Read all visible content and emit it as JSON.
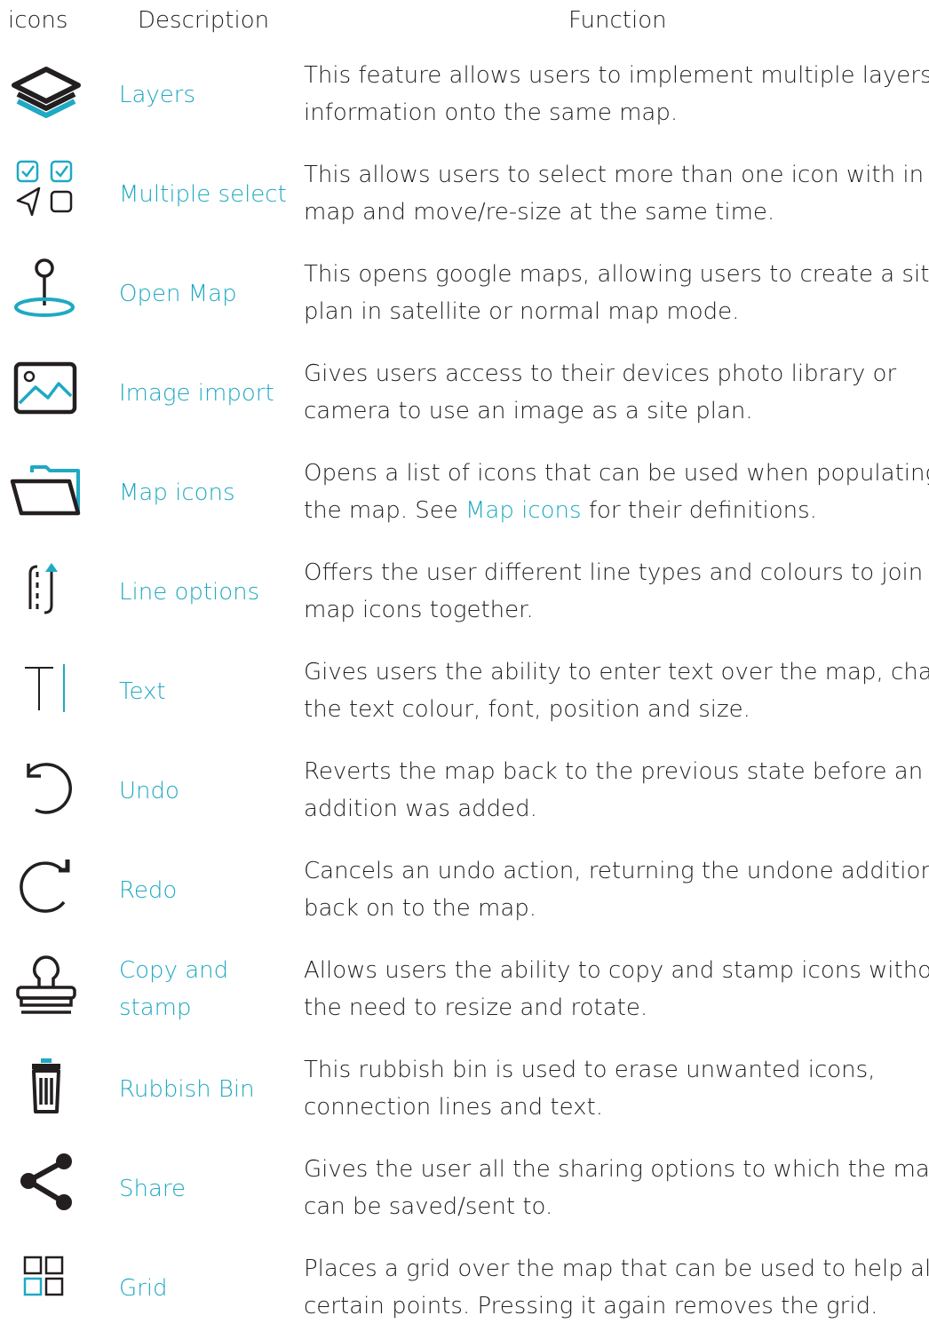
{
  "header": {
    "icons": "icons",
    "description": "Description",
    "function": "Function"
  },
  "colors": {
    "accent": "#1fa9c3",
    "text": "#231f20"
  },
  "rows": [
    {
      "icon": "layers-icon",
      "label": "Layers",
      "lines": [
        "This feature allows users to implement multiple layers of",
        "information onto the same map."
      ]
    },
    {
      "icon": "multiple-select-icon",
      "label": "Multiple select",
      "lines": [
        "This allows users to select more than one icon with in the",
        "map and move/re-size at the same time."
      ]
    },
    {
      "icon": "map-pin-icon",
      "label": "Open Map",
      "lines": [
        "This opens google maps, allowing users to create a site",
        "plan in satellite or normal map mode."
      ]
    },
    {
      "icon": "image-icon",
      "label": "Image import",
      "lines": [
        "Gives users access to their devices photo library or",
        "camera to use an image as a site plan."
      ]
    },
    {
      "icon": "folder-icon",
      "label": "Map icons",
      "lines": [
        "Opens a list of icons that can be used when populating"
      ],
      "line2_pre": "the map. See ",
      "line2_link": "Map icons",
      "line2_post": " for their definitions."
    },
    {
      "icon": "line-options-icon",
      "label": "Line options",
      "lines": [
        "Offers the user different line types and colours to join the",
        "map icons together."
      ]
    },
    {
      "icon": "text-cursor-icon",
      "label": "Text",
      "lines": [
        "Gives users the ability to enter text over the map, change",
        "the text colour, font, position and size."
      ]
    },
    {
      "icon": "undo-icon",
      "label": "Undo",
      "lines": [
        "Reverts the map back to the previous state before an",
        "addition was added."
      ]
    },
    {
      "icon": "redo-icon",
      "label": "Redo",
      "lines": [
        "Cancels an undo action, returning the undone addition",
        "back on to the map."
      ]
    },
    {
      "icon": "stamp-icon",
      "label": "Copy and stamp",
      "label_lines": [
        "Copy and",
        "stamp"
      ],
      "lines": [
        "Allows users the ability to copy and stamp icons without",
        "the need to resize and rotate."
      ]
    },
    {
      "icon": "trash-icon",
      "label": "Rubbish Bin",
      "lines": [
        "This rubbish bin is used to erase unwanted icons,",
        "connection lines and text."
      ]
    },
    {
      "icon": "share-icon",
      "label": "Share",
      "lines": [
        "Gives the user all the sharing options to which the map",
        "can be saved/sent to."
      ]
    },
    {
      "icon": "grid-icon",
      "label": "Grid",
      "lines": [
        "Places a grid over the map that can be used to help align",
        "certain points. Pressing it again removes the grid."
      ]
    }
  ]
}
